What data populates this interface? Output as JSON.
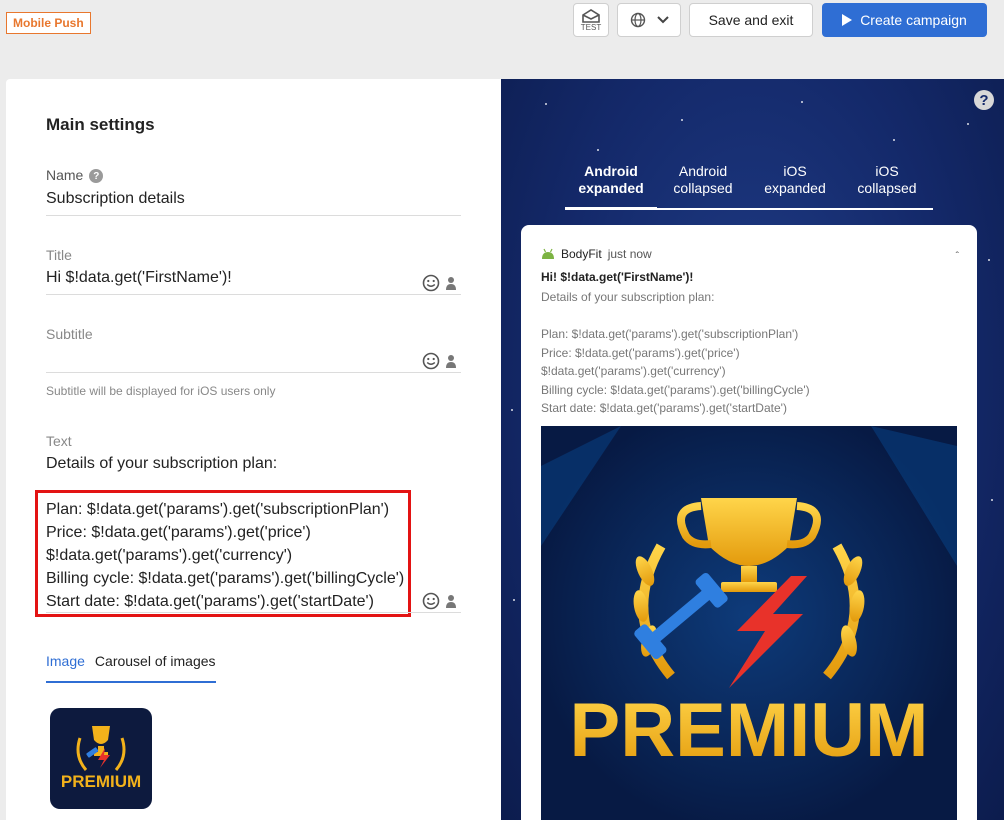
{
  "header": {
    "badge": "Mobile Push",
    "test_label": "TEST",
    "save_label": "Save and exit",
    "create_label": "Create campaign"
  },
  "settings": {
    "section_title": "Main settings",
    "name_label": "Name",
    "name_value": "Subscription details",
    "title_label": "Title",
    "title_value": "Hi  $!data.get('FirstName')!",
    "subtitle_label": "Subtitle",
    "subtitle_hint": "Subtitle will be displayed for iOS users only",
    "text_label": "Text",
    "text_lines": [
      "Details of your subscription plan:",
      "",
      "Plan: $!data.get('params').get('subscriptionPlan')",
      "Price: $!data.get('params').get('price')",
      "$!data.get('params').get('currency')",
      "Billing cycle: $!data.get('params').get('billingCycle')",
      "Start date: $!data.get('params').get('startDate')"
    ],
    "image_tabs": [
      "Image",
      "Carousel of images"
    ],
    "thumbnail_text": "PREMIUM"
  },
  "preview": {
    "tabs": [
      {
        "line1": "Android",
        "line2": "expanded"
      },
      {
        "line1": "Android",
        "line2": "collapsed"
      },
      {
        "line1": "iOS",
        "line2": "expanded"
      },
      {
        "line1": "iOS",
        "line2": "collapsed"
      }
    ],
    "app_name": "BodyFit",
    "time": "just now",
    "title": "Hi! $!data.get('FirstName')!",
    "text_lines": [
      "Details of your subscription plan:",
      "",
      "Plan: $!data.get('params').get('subscriptionPlan')",
      "Price: $!data.get('params').get('price')",
      "$!data.get('params').get('currency')",
      "Billing cycle: $!data.get('params').get('billingCycle')",
      "Start date: $!data.get('params').get('startDate')"
    ],
    "image_text": "PREMIUM"
  },
  "colors": {
    "accent": "#2f6ed4",
    "badge": "#e8772e",
    "highlight": "#e31313",
    "preview_bg": "#14296a",
    "premium_gold": "#f2b21b"
  }
}
